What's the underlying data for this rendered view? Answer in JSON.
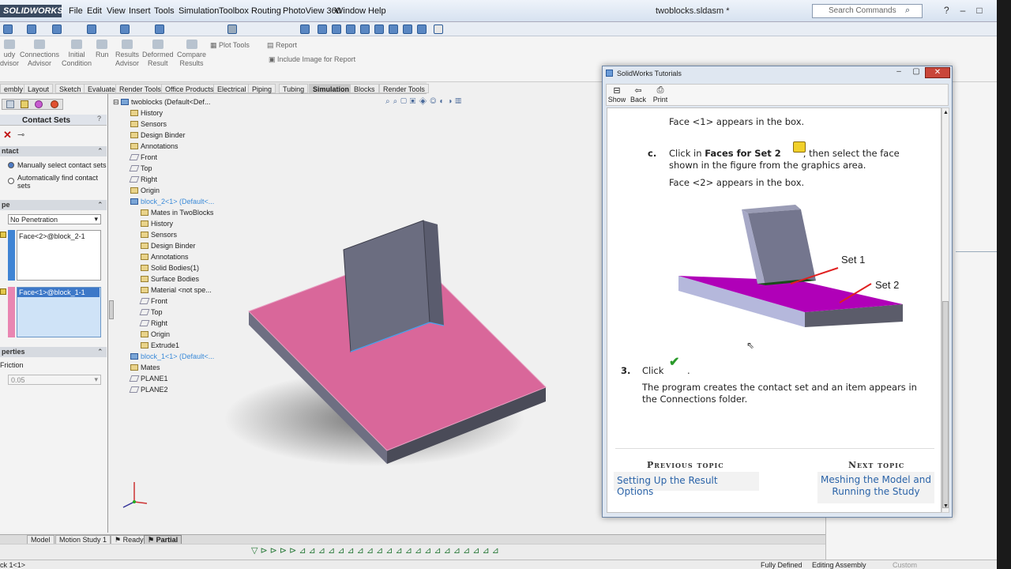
{
  "app": {
    "logo": "SOLIDWORKS",
    "doc_title": "twoblocks.sldasm *",
    "search_placeholder": "Search Commands",
    "menu": [
      "File",
      "Edit",
      "View",
      "Insert",
      "Tools",
      "Simulation",
      "Toolbox",
      "Routing",
      "PhotoView 360",
      "Window",
      "Help"
    ]
  },
  "commands": {
    "study_advisor": "udy\ndvisor",
    "connections_advisor": "Connections\nAdvisor",
    "initial_condition": "Initial\nCondition",
    "run": "Run",
    "results_advisor": "Results\nAdvisor",
    "deformed_result": "Deformed\nResult",
    "compare_results": "Compare\nResults",
    "plot_tools": "Plot Tools",
    "report": "Report",
    "include_image": "Include Image for Report"
  },
  "tabs": [
    "embly",
    "Layout",
    "Sketch",
    "Evaluate",
    "Render Tools",
    "Office Products",
    "Electrical",
    "Piping",
    "Tubing",
    "Simulation",
    "Blocks",
    "Render Tools"
  ],
  "active_tab": "Simulation",
  "contact_panel": {
    "title": "Contact Sets",
    "section_contact": "ntact",
    "option_manual": "Manually select contact sets",
    "option_auto": "Automatically find contact sets",
    "section_type": "pe",
    "type_value": "No Penetration",
    "face_set1": "Face<2>@block_2-1",
    "face_set2": "Face<1>@block_1-1",
    "section_properties": "perties",
    "friction_label": "Friction",
    "friction_value": "0.05"
  },
  "tree": {
    "root": "twoblocks  (Default<Def...",
    "items": [
      "History",
      "Sensors",
      "Design Binder",
      "Annotations",
      "Front",
      "Top",
      "Right",
      "Origin"
    ],
    "block2": "block_2<1> (Default<...",
    "block2_items": [
      "Mates in TwoBlocks",
      "History",
      "Sensors",
      "Design Binder",
      "Annotations",
      "Solid Bodies(1)",
      "Surface Bodies",
      "Material <not spe...",
      "Front",
      "Top",
      "Right",
      "Origin",
      "Extrude1"
    ],
    "block1": "block_1<1> (Default<...",
    "tail": [
      "Mates",
      "PLANE1",
      "PLANE2"
    ]
  },
  "bottom_tabs": [
    "Model",
    "Motion Study 1",
    "Ready",
    "Partial"
  ],
  "status": {
    "left": "ck 1<1>",
    "fully_defined": "Fully Defined",
    "editing": "Editing Assembly",
    "custom": "Custom"
  },
  "tutorial": {
    "window_title": "SolidWorks Tutorials",
    "btn_show": "Show",
    "btn_back": "Back",
    "btn_print": "Print",
    "face1_line": "Face <1> appears in the box.",
    "step_c_letter": "c.",
    "step_c_pre": "Click in ",
    "step_c_bold": "Faces for Set 2",
    "step_c_post": ", then select the face",
    "step_c_line2": "shown in the figure from the graphics area.",
    "face2_line": "Face <2> appears in the box.",
    "fig_set1": "Set 1",
    "fig_set2": "Set 2",
    "step3_num": "3.",
    "step3_click": "Click",
    "step3_period": ".",
    "step3_body": "The program creates the contact set and an item appears in the Connections folder.",
    "prev_heading": "Previous topic",
    "prev_link": "Setting Up the Result Options",
    "next_heading": "Next topic",
    "next_link": "Meshing the Model and Running the Study"
  },
  "colors": {
    "pink_face": "#d9679a",
    "block_gray": "#6b6d80",
    "magenta": "#b000b8",
    "link_blue": "#2a63a8"
  }
}
